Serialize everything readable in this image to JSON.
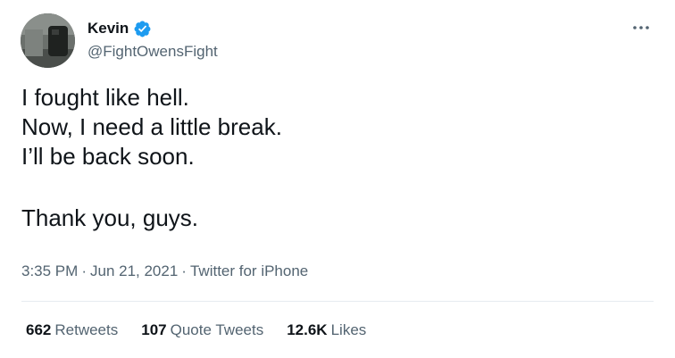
{
  "author": {
    "display_name": "Kevin",
    "handle": "@FightOwensFight",
    "verified": true,
    "avatar_icon": "profile-photo"
  },
  "more_icon": "more-dots-icon",
  "tweet": {
    "lines": [
      "I fought like hell.",
      "Now, I need a little break.",
      "I’ll be back soon.",
      "Thank you, guys."
    ]
  },
  "meta": {
    "time": "3:35 PM",
    "separator": "·",
    "date": "Jun 21, 2021",
    "source": "Twitter for iPhone"
  },
  "stats": {
    "retweets": {
      "count": "662",
      "label": "Retweets"
    },
    "quote_tweets": {
      "count": "107",
      "label": "Quote Tweets"
    },
    "likes": {
      "count": "12.6K",
      "label": "Likes"
    }
  },
  "colors": {
    "verified_blue": "#1d9bf0",
    "secondary_text": "#536471",
    "primary_text": "#0f1419",
    "divider": "#e6ecf0"
  }
}
